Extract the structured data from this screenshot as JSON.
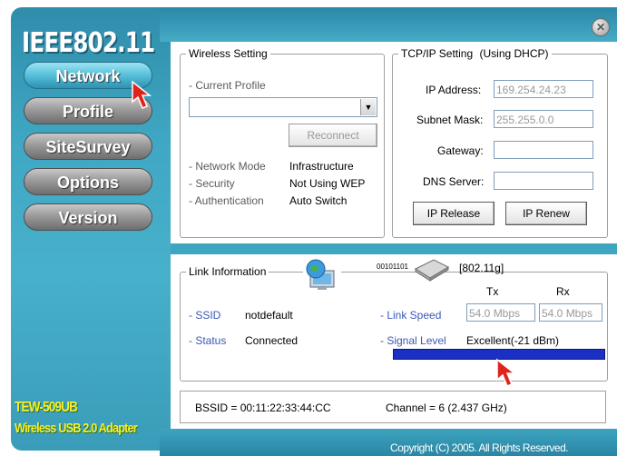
{
  "sidebar": {
    "title": "IEEE802.11",
    "nav": [
      {
        "label": "Network"
      },
      {
        "label": "Profile"
      },
      {
        "label": "SiteSurvey"
      },
      {
        "label": "Options"
      },
      {
        "label": "Version"
      }
    ],
    "brand_model": "TEW-509UB",
    "brand_desc": "Wireless USB 2.0 Adapter"
  },
  "footer": {
    "copyright": "Copyright (C) 2005. All Rights Reserved."
  },
  "wireless": {
    "legend": "Wireless Setting",
    "current_profile_label": "- Current Profile",
    "profile_value": "",
    "reconnect_label": "Reconnect",
    "network_mode_label": "- Network Mode",
    "network_mode_value": "Infrastructure",
    "security_label": "- Security",
    "security_value": "Not Using WEP",
    "authentication_label": "- Authentication",
    "authentication_value": "Auto Switch"
  },
  "tcpip": {
    "legend": "TCP/IP Setting",
    "dhcp_note": "(Using DHCP)",
    "ip_label": "IP Address:",
    "ip_value": "169.254.24.23",
    "mask_label": "Subnet Mask:",
    "mask_value": "255.255.0.0",
    "gateway_label": "Gateway:",
    "gateway_value": "",
    "dns_label": "DNS Server:",
    "dns_value": "",
    "release_label": "IP Release",
    "renew_label": "IP Renew"
  },
  "link": {
    "legend": "Link Information",
    "bits": "00101101",
    "standard": "[802.11g]",
    "tx_label": "Tx",
    "rx_label": "Rx",
    "ssid_label": "- SSID",
    "ssid_value": "notdefault",
    "status_label": "- Status",
    "status_value": "Connected",
    "speed_label": "- Link Speed",
    "tx_speed": "54.0 Mbps",
    "rx_speed": "54.0 Mbps",
    "signal_label": "- Signal Level",
    "signal_value": "Excellent(-21 dBm)",
    "signal_fraction": 1.0
  },
  "status_bar": {
    "bssid": "BSSID = 00:11:22:33:44:CC",
    "channel": "Channel = 6 (2.437 GHz)"
  },
  "colors": {
    "sidebar": "#3fa7c3",
    "active_nav": "#5bc3dc",
    "signal_bar": "#1a2fc4",
    "brand_text": "#f5ef2b",
    "label_blue": "#3a58b6"
  },
  "icons": [
    "close-icon",
    "cursor-arrow-icon",
    "globe-computer-icon",
    "usb-adapter-icon"
  ]
}
